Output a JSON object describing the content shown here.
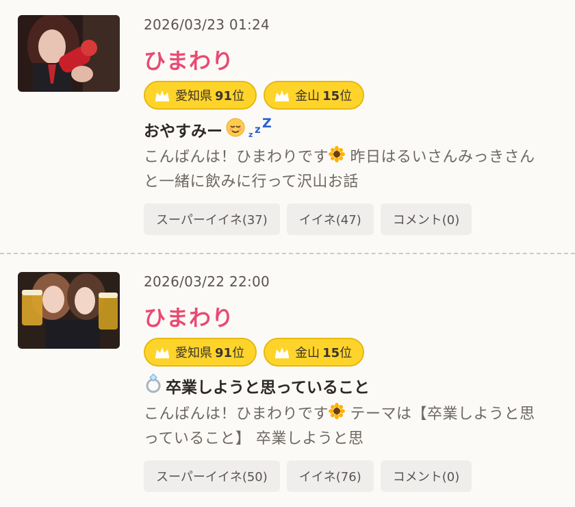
{
  "posts": [
    {
      "date": "2026/03/23 01:24",
      "author": "ひまわり",
      "badges": [
        {
          "prefix": "愛知県",
          "rank": "91",
          "suffix": "位"
        },
        {
          "prefix": "金山",
          "rank": "15",
          "suffix": "位"
        }
      ],
      "title": "おやすみー",
      "title_emoji": [
        "relieved-face",
        "zzz"
      ],
      "excerpt_1": "こんばんは！ひまわりです",
      "excerpt_2": " 昨日はるいさんみっきさんと一緒に飲みに行って沢山お話",
      "excerpt_emoji": "sunflower",
      "actions": {
        "super_like": "スーパーイイネ(37)",
        "like": "イイネ(47)",
        "comment": "コメント(0)"
      }
    },
    {
      "date": "2026/03/22 22:00",
      "author": "ひまわり",
      "badges": [
        {
          "prefix": "愛知県",
          "rank": "91",
          "suffix": "位"
        },
        {
          "prefix": "金山",
          "rank": "15",
          "suffix": "位"
        }
      ],
      "title": "卒業しようと思っていること",
      "title_emoji": [
        "ring"
      ],
      "excerpt_1": "こんばんは！ひまわりです",
      "excerpt_2": " テーマは【卒業しようと思っていること】 卒業しようと思",
      "excerpt_emoji": "sunflower",
      "actions": {
        "super_like": "スーパーイイネ(50)",
        "like": "イイネ(76)",
        "comment": "コメント(0)"
      }
    }
  ],
  "colors": {
    "author": "#e94a72",
    "badge_bg": "#ffd42a",
    "badge_border": "#e6b810",
    "button_bg": "#efeeec",
    "page_bg": "#fbfaf7"
  }
}
